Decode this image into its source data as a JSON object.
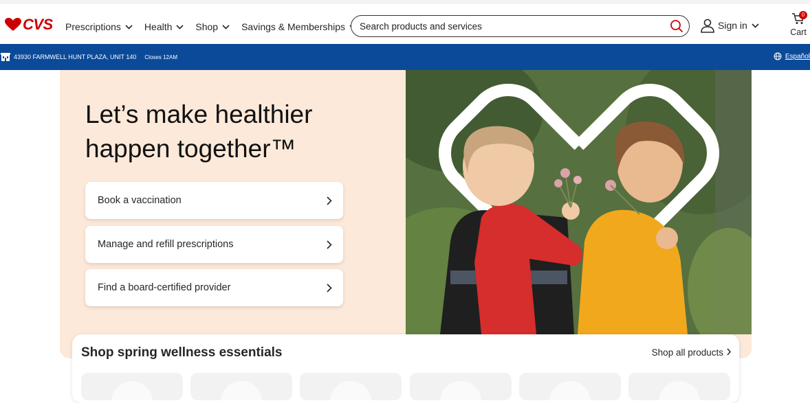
{
  "brand": {
    "name": "CVS",
    "color": "#cc0000"
  },
  "nav": {
    "items": [
      {
        "label": "Prescriptions"
      },
      {
        "label": "Health"
      },
      {
        "label": "Shop"
      },
      {
        "label": "Savings & Memberships"
      }
    ]
  },
  "search": {
    "placeholder": "Search products and services",
    "icon": "search-icon",
    "icon_color": "#cc0000"
  },
  "account": {
    "sign_in_label": "Sign in"
  },
  "cart": {
    "label": "Cart",
    "count": "0"
  },
  "store": {
    "address": "43930 FARMWELL HUNT PLAZA, UNIT 140",
    "hours": "Closes 12AM",
    "language_label": "Español",
    "bar_color": "#0b4a99"
  },
  "hero": {
    "title": "Let’s make healthier happen together™",
    "background": "#fde9d9",
    "actions": [
      {
        "label": "Book a vaccination"
      },
      {
        "label": "Manage and refill prescriptions"
      },
      {
        "label": "Find a board-certified provider"
      }
    ]
  },
  "shop": {
    "title": "Shop spring wellness essentials",
    "link_label": "Shop all products",
    "tile_count": 6
  }
}
